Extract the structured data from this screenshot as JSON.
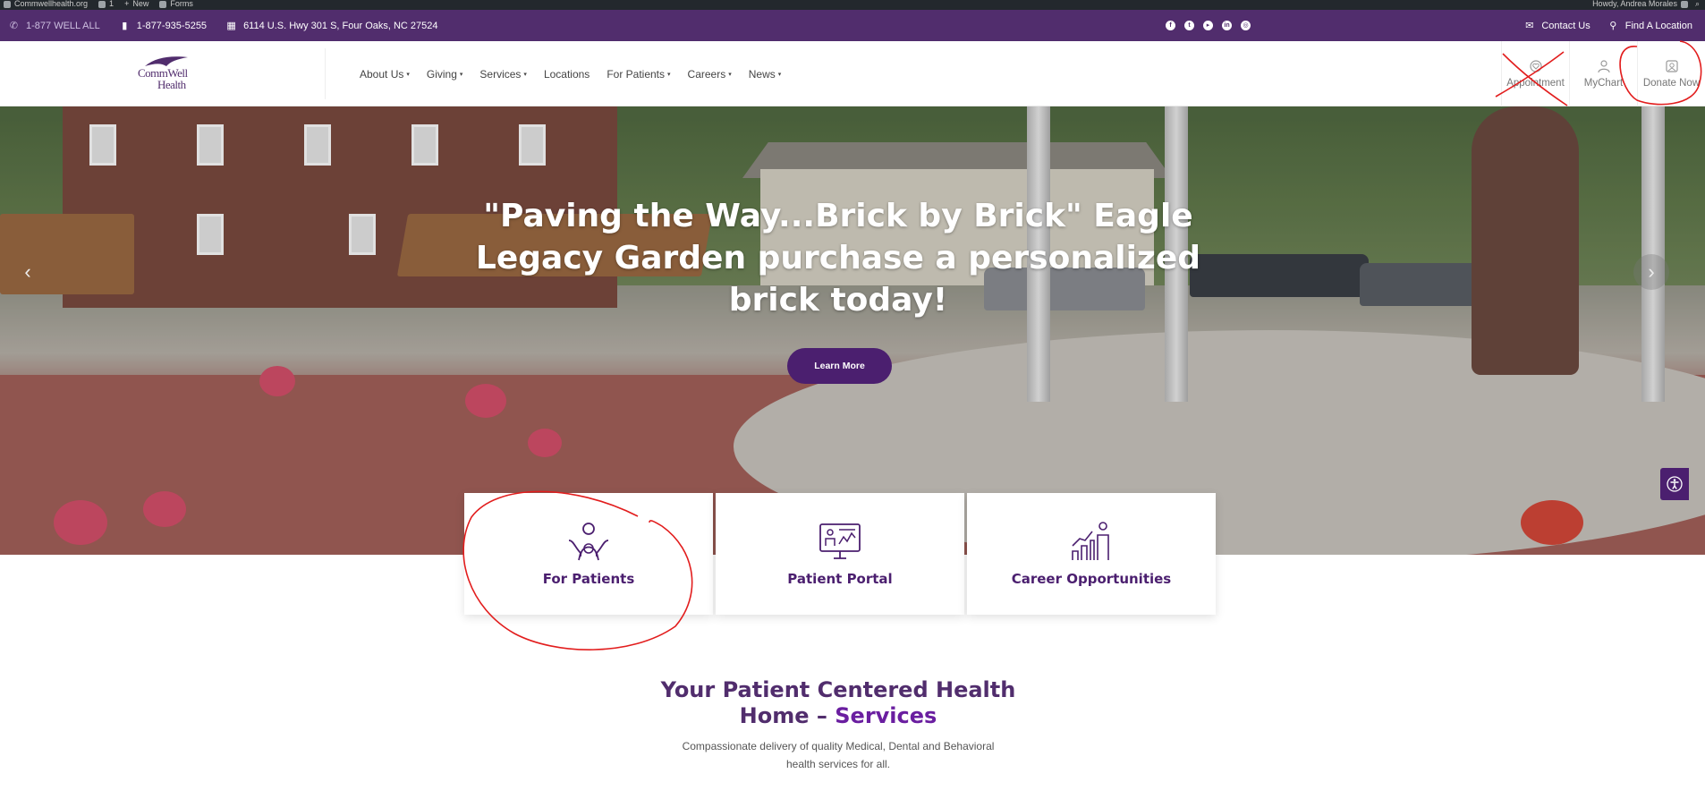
{
  "admin_bar": {
    "site": "Commwellhealth.org",
    "comments": "1",
    "new": "New",
    "forms": "Forms",
    "greeting": "Howdy, Andrea Morales"
  },
  "topbar": {
    "phone_label": "1-877 WELL ALL",
    "phone_number": "1-877-935-5255",
    "address": "6114 U.S. Hwy 301 S, Four Oaks, NC 27524",
    "social_icons": [
      "facebook-icon",
      "twitter-icon",
      "youtube-icon",
      "linkedin-icon",
      "instagram-icon"
    ],
    "contact": "Contact Us",
    "find_location": "Find A Location"
  },
  "header": {
    "logo_line1": "CommWell",
    "logo_line2": "Health",
    "nav": [
      {
        "label": "About Us",
        "dropdown": true
      },
      {
        "label": "Giving",
        "dropdown": true
      },
      {
        "label": "Services",
        "dropdown": true
      },
      {
        "label": "Locations",
        "dropdown": false
      },
      {
        "label": "For Patients",
        "dropdown": true
      },
      {
        "label": "Careers",
        "dropdown": true
      },
      {
        "label": "News",
        "dropdown": true
      }
    ],
    "caret": "▾",
    "buttons": [
      {
        "label": "Appointment",
        "icon": "calendar-heart-icon"
      },
      {
        "label": "MyChart",
        "icon": "user-icon"
      },
      {
        "label": "Donate Now",
        "icon": "donate-icon"
      }
    ]
  },
  "hero": {
    "title": "\"Paving the Way...Brick by Brick\" Eagle Legacy Garden purchase a personalized brick today!",
    "button": "Learn More",
    "prev_glyph": "‹",
    "next_glyph": "›"
  },
  "cards": [
    {
      "label": "For Patients",
      "icon": "patient-care-icon"
    },
    {
      "label": "Patient Portal",
      "icon": "portal-monitor-icon"
    },
    {
      "label": "Career Opportunities",
      "icon": "career-growth-icon"
    }
  ],
  "section": {
    "title_line1": "Your Patient Centered Health",
    "title_line2_a": "Home – ",
    "title_line2_b": "Services",
    "subtitle": "Compassionate delivery of quality Medical, Dental and Behavioral health services for all."
  },
  "colors": {
    "brand_purple": "#512d6d",
    "button_purple": "#4b1f6f",
    "annotation_red": "#e21d1d"
  }
}
